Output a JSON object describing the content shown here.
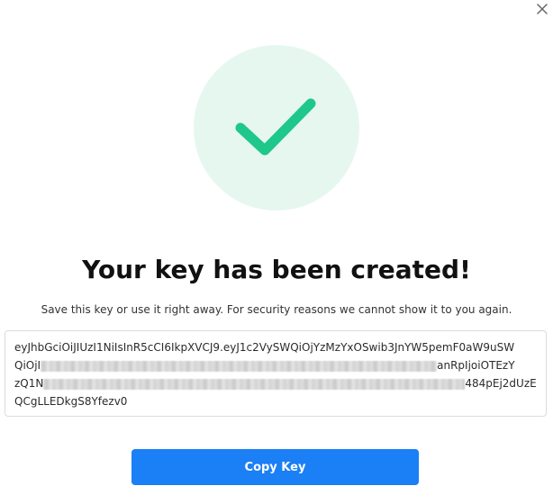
{
  "dialog": {
    "close_icon": "close-icon",
    "success_icon": "checkmark-icon",
    "title": "Your key has been created!",
    "subtitle": "Save this key or use it right away. For security reasons we cannot show it to you again.",
    "key": {
      "line1": "eyJhbGciOiJIUzI1NiIsInR5cCI6IkpXVCJ9.eyJ1c2VySWQiOjYzMzYxOSwib3JnYW5pemF0aW9uSW",
      "line2_start": "QiOjI",
      "line2_end": "anRpIjoiOTEzY",
      "line3_start": "zQ1N",
      "line3_end": "484pEj2dUzE",
      "line4": "QCgLLEDkgS8Yfezv0"
    },
    "copy_button_label": "Copy Key"
  },
  "colors": {
    "accent": "#1b7ff5",
    "success": "#1ec78a",
    "success_bg": "#e6f7f0"
  }
}
